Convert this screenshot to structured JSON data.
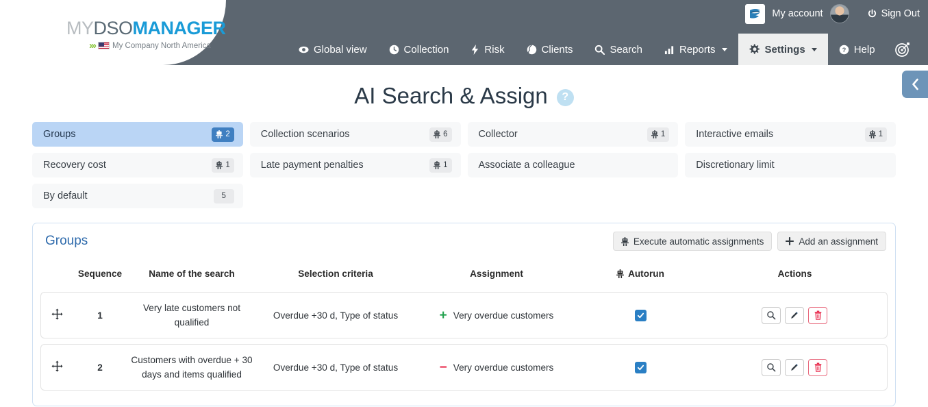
{
  "brand": {
    "logo_my": "MY",
    "logo_dso": "DSO",
    "logo_manager": "MANAGER",
    "chevrons": "›››",
    "company": "My Company North America",
    "flag_icon": "us-flag-icon",
    "swoosh_icon": "mydso-swoosh-logo-icon"
  },
  "account": {
    "app_logo_icon": "app-logo-icon",
    "my_account_label": "My account",
    "avatar_icon": "user-avatar",
    "signout_label": "Sign Out",
    "power_icon": "power-icon"
  },
  "nav": {
    "items": [
      {
        "label": "Global view",
        "icon": "eye-icon",
        "active": false,
        "caret": false
      },
      {
        "label": "Collection",
        "icon": "clock-icon",
        "active": false,
        "caret": false
      },
      {
        "label": "Risk",
        "icon": "bolt-icon",
        "active": false,
        "caret": false
      },
      {
        "label": "Clients",
        "icon": "globe-icon",
        "active": false,
        "caret": false
      },
      {
        "label": "Search",
        "icon": "magnifier-icon",
        "active": false,
        "caret": false
      },
      {
        "label": "Reports",
        "icon": "bar-chart-icon",
        "active": false,
        "caret": true
      },
      {
        "label": "Settings",
        "icon": "gear-icon",
        "active": true,
        "caret": true
      },
      {
        "label": "Help",
        "icon": "question-circle-icon",
        "active": false,
        "caret": false
      }
    ],
    "target_icon": "target-icon",
    "search_icon": "search-icon"
  },
  "header": {
    "page_title": "AI Search & Assign",
    "help_badge": "?",
    "collapse_icon": "chevron-left-icon"
  },
  "categories": [
    {
      "label": "Groups",
      "count": "2",
      "robot": true,
      "active": true
    },
    {
      "label": "Collection scenarios",
      "count": "6",
      "robot": true,
      "active": false
    },
    {
      "label": "Collector",
      "count": "1",
      "robot": true,
      "active": false
    },
    {
      "label": "Interactive emails",
      "count": "1",
      "robot": true,
      "active": false
    },
    {
      "label": "Recovery cost",
      "count": "1",
      "robot": true,
      "active": false
    },
    {
      "label": "Late payment penalties",
      "count": "1",
      "robot": true,
      "active": false
    },
    {
      "label": "Associate a colleague",
      "count": "",
      "robot": false,
      "active": false
    },
    {
      "label": "Discretionary limit",
      "count": "",
      "robot": false,
      "active": false
    },
    {
      "label": "By default",
      "count": "5",
      "robot": false,
      "active": false
    }
  ],
  "panel": {
    "title": "Groups",
    "execute_label": "Execute automatic assignments",
    "execute_icon": "robot-icon",
    "add_label": "Add an assignment",
    "add_icon": "plus-icon"
  },
  "table": {
    "columns": {
      "drag": "",
      "sequence": "Sequence",
      "name": "Name of the search",
      "criteria": "Selection criteria",
      "assignment": "Assignment",
      "autorun": "Autorun",
      "autorun_icon": "robot-icon",
      "actions": "Actions"
    },
    "rows": [
      {
        "drag_icon": "drag-move-icon",
        "sequence": "1",
        "name": "Very late customers not qualified",
        "criteria": "Overdue +30 d, Type of status",
        "assignment_sign": "+",
        "assignment": "Very overdue customers",
        "autorun_checked": true,
        "actions": [
          "view-icon",
          "edit-icon",
          "delete-icon"
        ]
      },
      {
        "drag_icon": "drag-move-icon",
        "sequence": "2",
        "name": "Customers with overdue + 30 days and items qualified",
        "criteria": "Overdue +30 d, Type of status",
        "assignment_sign": "−",
        "assignment": "Very overdue customers",
        "autorun_checked": true,
        "actions": [
          "view-icon",
          "edit-icon",
          "delete-icon"
        ]
      }
    ]
  },
  "colors": {
    "header_bg": "#5c6670",
    "active_nav_bg": "#eeefef",
    "brand_blue": "#1a9bd7",
    "panel_border": "#cfe0f2",
    "panel_title": "#2f6bac",
    "active_card_bg": "#bad5f5",
    "active_badge_bg": "#3f7fc1",
    "checkbox_blue": "#2a7fc4",
    "plus_green": "#22a14e",
    "minus_red": "#e8294b",
    "delete_red": "#e8697d",
    "collapse_tab": "#6d94b8"
  }
}
